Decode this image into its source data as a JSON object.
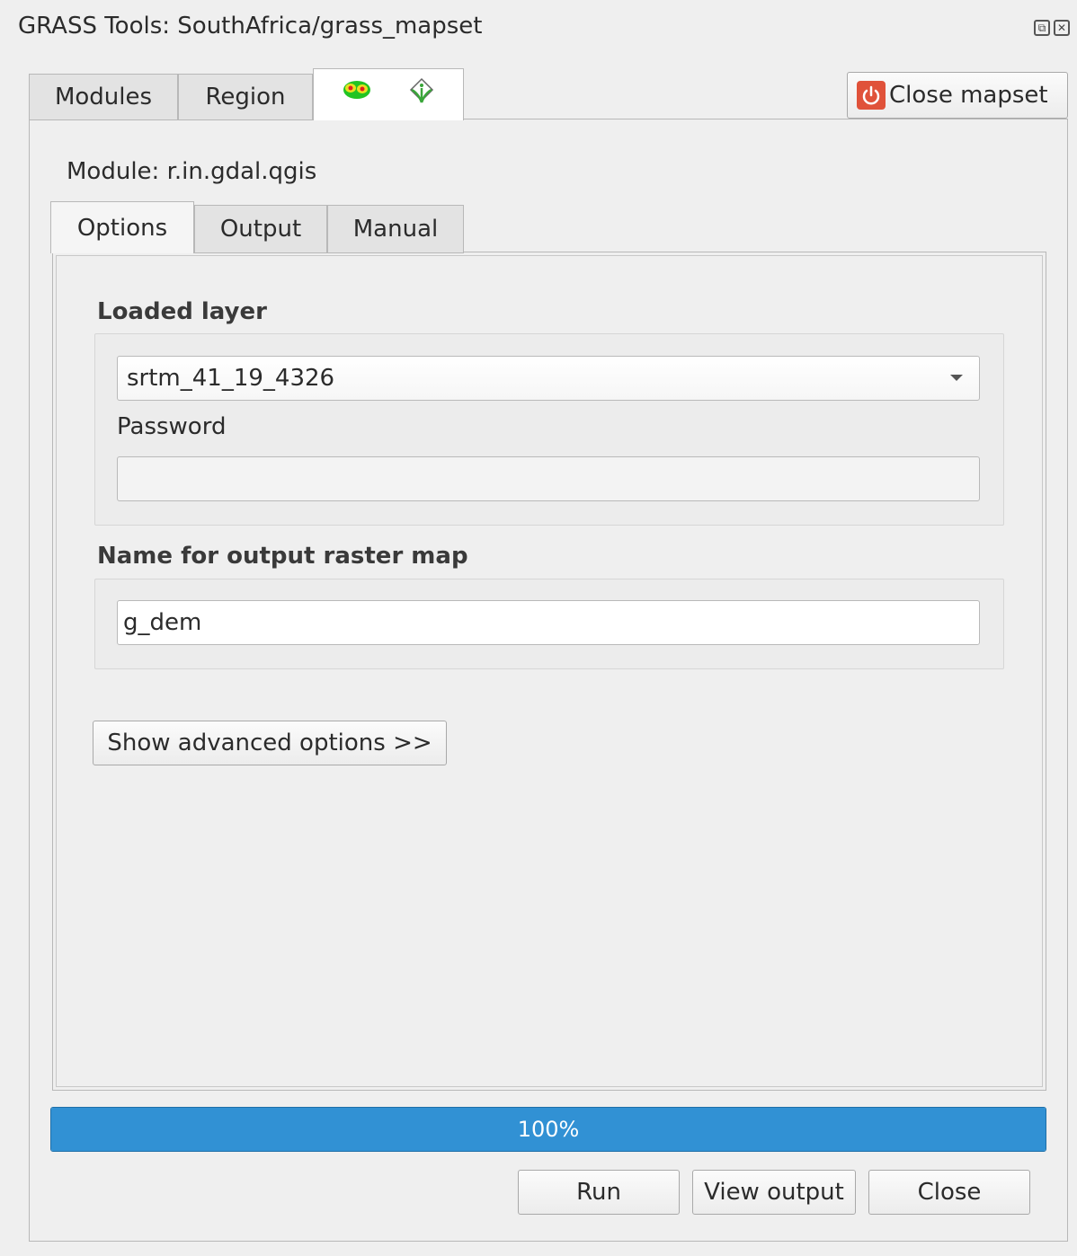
{
  "window": {
    "title": "GRASS Tools: SouthAfrica/grass_mapset"
  },
  "outer_tabs": [
    {
      "label": "Modules"
    },
    {
      "label": "Region"
    },
    {
      "label": "",
      "icons": [
        "heatmap-icon",
        "grass-module-icon"
      ]
    }
  ],
  "close_mapset_label": "Close mapset",
  "module": {
    "label": "Module: r.in.gdal.qgis"
  },
  "inner_tabs": [
    {
      "label": "Options"
    },
    {
      "label": "Output"
    },
    {
      "label": "Manual"
    }
  ],
  "options": {
    "loaded_layer_title": "Loaded layer",
    "loaded_layer_value": "srtm_41_19_4326",
    "password_label": "Password",
    "password_value": "",
    "output_title": "Name for output raster map",
    "output_value": "g_dem",
    "advanced_label": "Show advanced options >>"
  },
  "progress": {
    "value": 1.0,
    "text": "100%"
  },
  "buttons": {
    "run": "Run",
    "view_output": "View output",
    "close": "Close"
  },
  "colors": {
    "progress_fill": "#3191d4",
    "close_icon": "#e0523a"
  }
}
